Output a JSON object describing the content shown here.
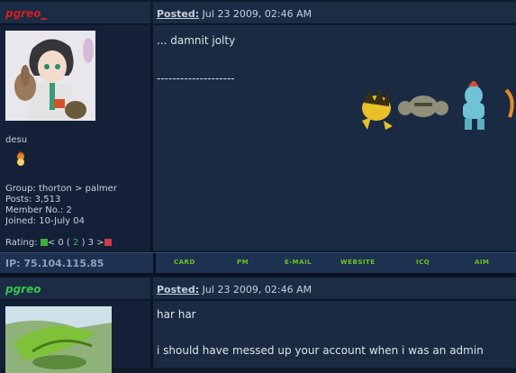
{
  "post1": {
    "username": "pgreo",
    "username_suffix": "_",
    "posted_label": "Posted:",
    "posted_date": "Jul 23 2009, 02:46 AM",
    "title": "desu",
    "group": "Group: thorton > palmer",
    "posts": "Posts: 3,513",
    "member_no": "Member No.: 2",
    "joined": "Joined: 10-July 04",
    "rating_label": "Rating:",
    "rating_left": "< 0 (",
    "rating_value": "2",
    "rating_right": ") 3 >",
    "body_line1": "... damnit jolty",
    "signature_line": "--------------------",
    "ip": "IP: 75.104.115.85",
    "footer_buttons": [
      "CARD",
      "PM",
      "E-MAIL",
      "WEBSITE",
      "ICQ",
      "AIM"
    ]
  },
  "post2": {
    "username": "pgreo",
    "posted_label": "Posted:",
    "posted_date": "Jul 23 2009, 02:46 AM",
    "body_line1": "har har",
    "body_line2": "i should have messed up your account when i was an admin"
  },
  "colors": {
    "username1": "#d21f1f",
    "username2": "#37c54a",
    "footer_button": "#6cc41f"
  }
}
